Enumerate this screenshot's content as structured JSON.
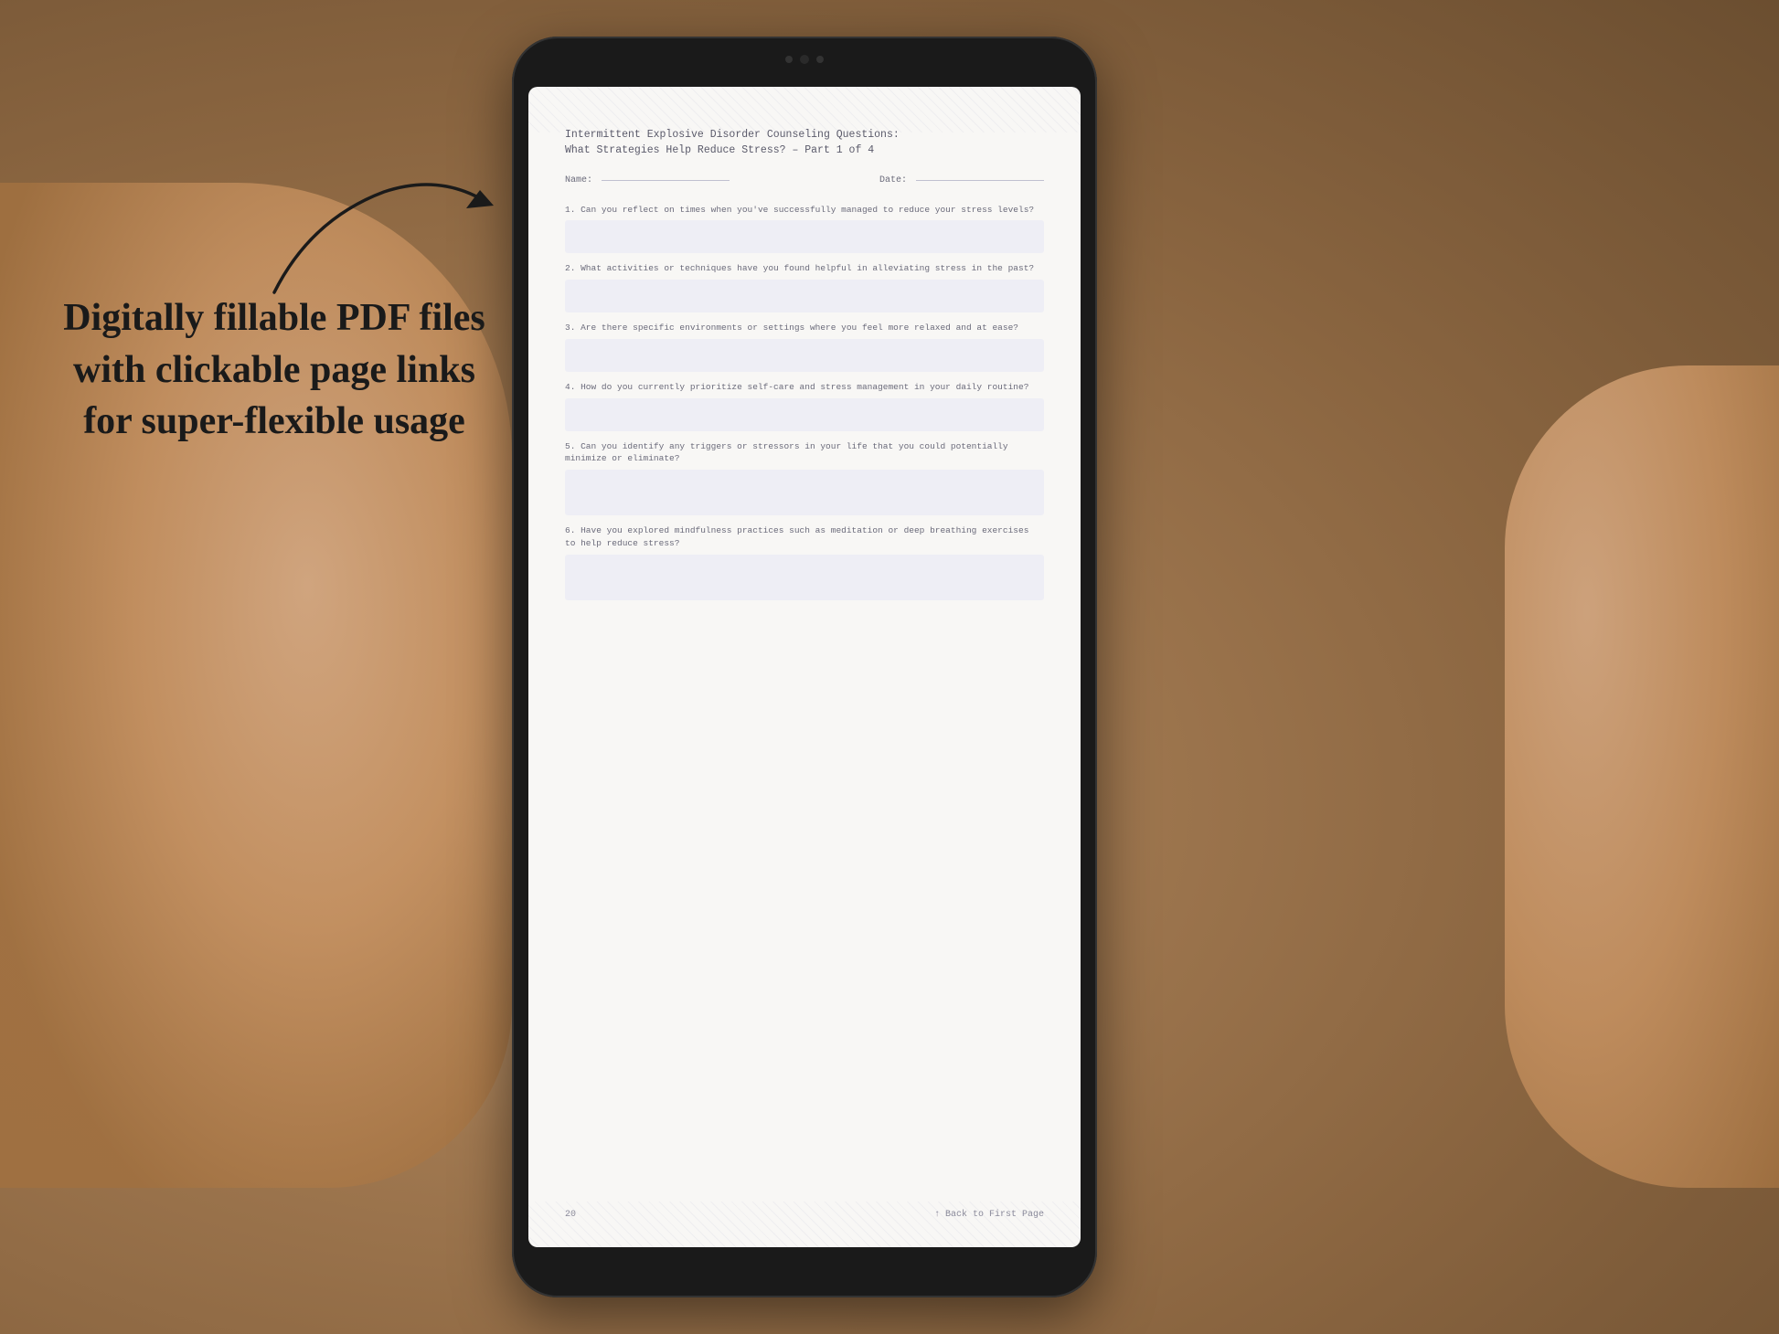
{
  "background": {
    "color": "#b8956a"
  },
  "left_text": {
    "line1": "Digitally fillable PDF files",
    "line2": "with clickable page links",
    "line3": "for super-flexible usage"
  },
  "tablet": {
    "pdf": {
      "title_line1": "Intermittent Explosive Disorder Counseling Questions:",
      "title_line2": "What Strategies Help Reduce Stress? – Part 1 of 4",
      "name_label": "Name:",
      "date_label": "Date:",
      "questions": [
        {
          "number": "1.",
          "text": "Can you reflect on times when you've successfully managed to reduce your stress levels?"
        },
        {
          "number": "2.",
          "text": "What activities or techniques have you found helpful in alleviating stress in the past?"
        },
        {
          "number": "3.",
          "text": "Are there specific environments or settings where you feel more relaxed and at ease?"
        },
        {
          "number": "4.",
          "text": "How do you currently prioritize self-care and stress management in your daily routine?"
        },
        {
          "number": "5.",
          "text": "Can you identify any triggers or stressors in your life that you could potentially minimize or eliminate?"
        },
        {
          "number": "6.",
          "text": "Have you explored mindfulness practices such as meditation or deep breathing exercises to help reduce stress?"
        }
      ],
      "page_number": "20",
      "back_link": "↑ Back to First Page"
    }
  }
}
